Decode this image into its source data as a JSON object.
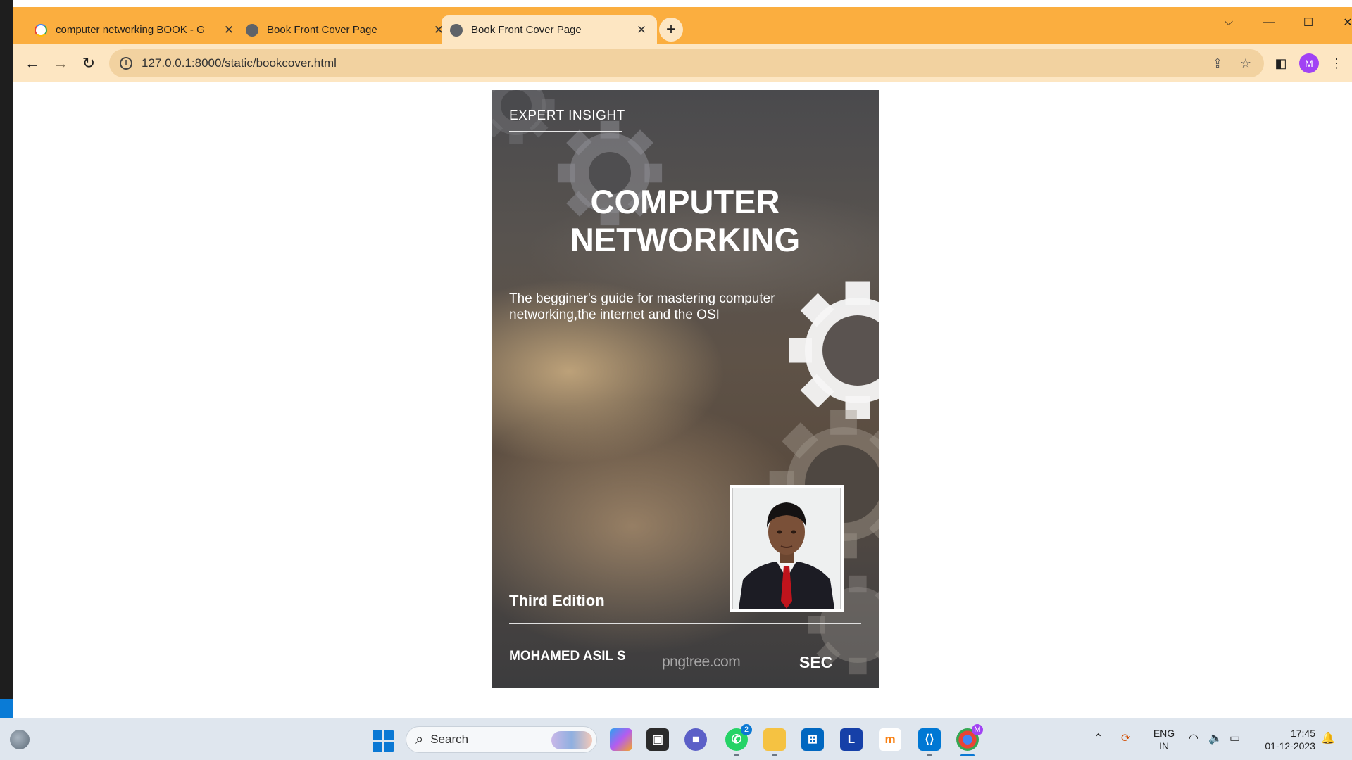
{
  "browser": {
    "tabs": [
      {
        "title": "computer networking BOOK - G",
        "favicon": "google-g-icon"
      },
      {
        "title": "Book Front Cover Page",
        "favicon": "globe-icon"
      },
      {
        "title": "Book Front Cover Page",
        "favicon": "globe-icon",
        "active": true
      }
    ],
    "url": "127.0.0.1:8000/static/bookcover.html",
    "profile_initial": "M",
    "tabstrip_color": "#fbae3f",
    "toolbar_color": "#fde6c2"
  },
  "cover": {
    "kicker": "EXPERT INSIGHT",
    "title_line1": "COMPUTER",
    "title_line2": "NETWORKING",
    "subtitle": "The begginer's guide for mastering computer networking,the internet and the OSI",
    "edition": "Third Edition",
    "author": "MOHAMED ASIL S",
    "watermark": "pngtree.com",
    "publisher": "SEC"
  },
  "taskbar": {
    "search_label": "Search",
    "whatsapp_badge": "2",
    "chrome_badge": "M",
    "lang_line1": "ENG",
    "lang_line2": "IN",
    "time": "17:45",
    "date": "01-12-2023",
    "apps": [
      "widgets-icon",
      "start-icon",
      "copilot-icon",
      "task-view-icon",
      "teams-icon",
      "whatsapp-icon",
      "file-explorer-icon",
      "microsoft-store-icon",
      "l-app-icon",
      "moodle-icon",
      "vscode-icon",
      "chrome-icon"
    ]
  }
}
